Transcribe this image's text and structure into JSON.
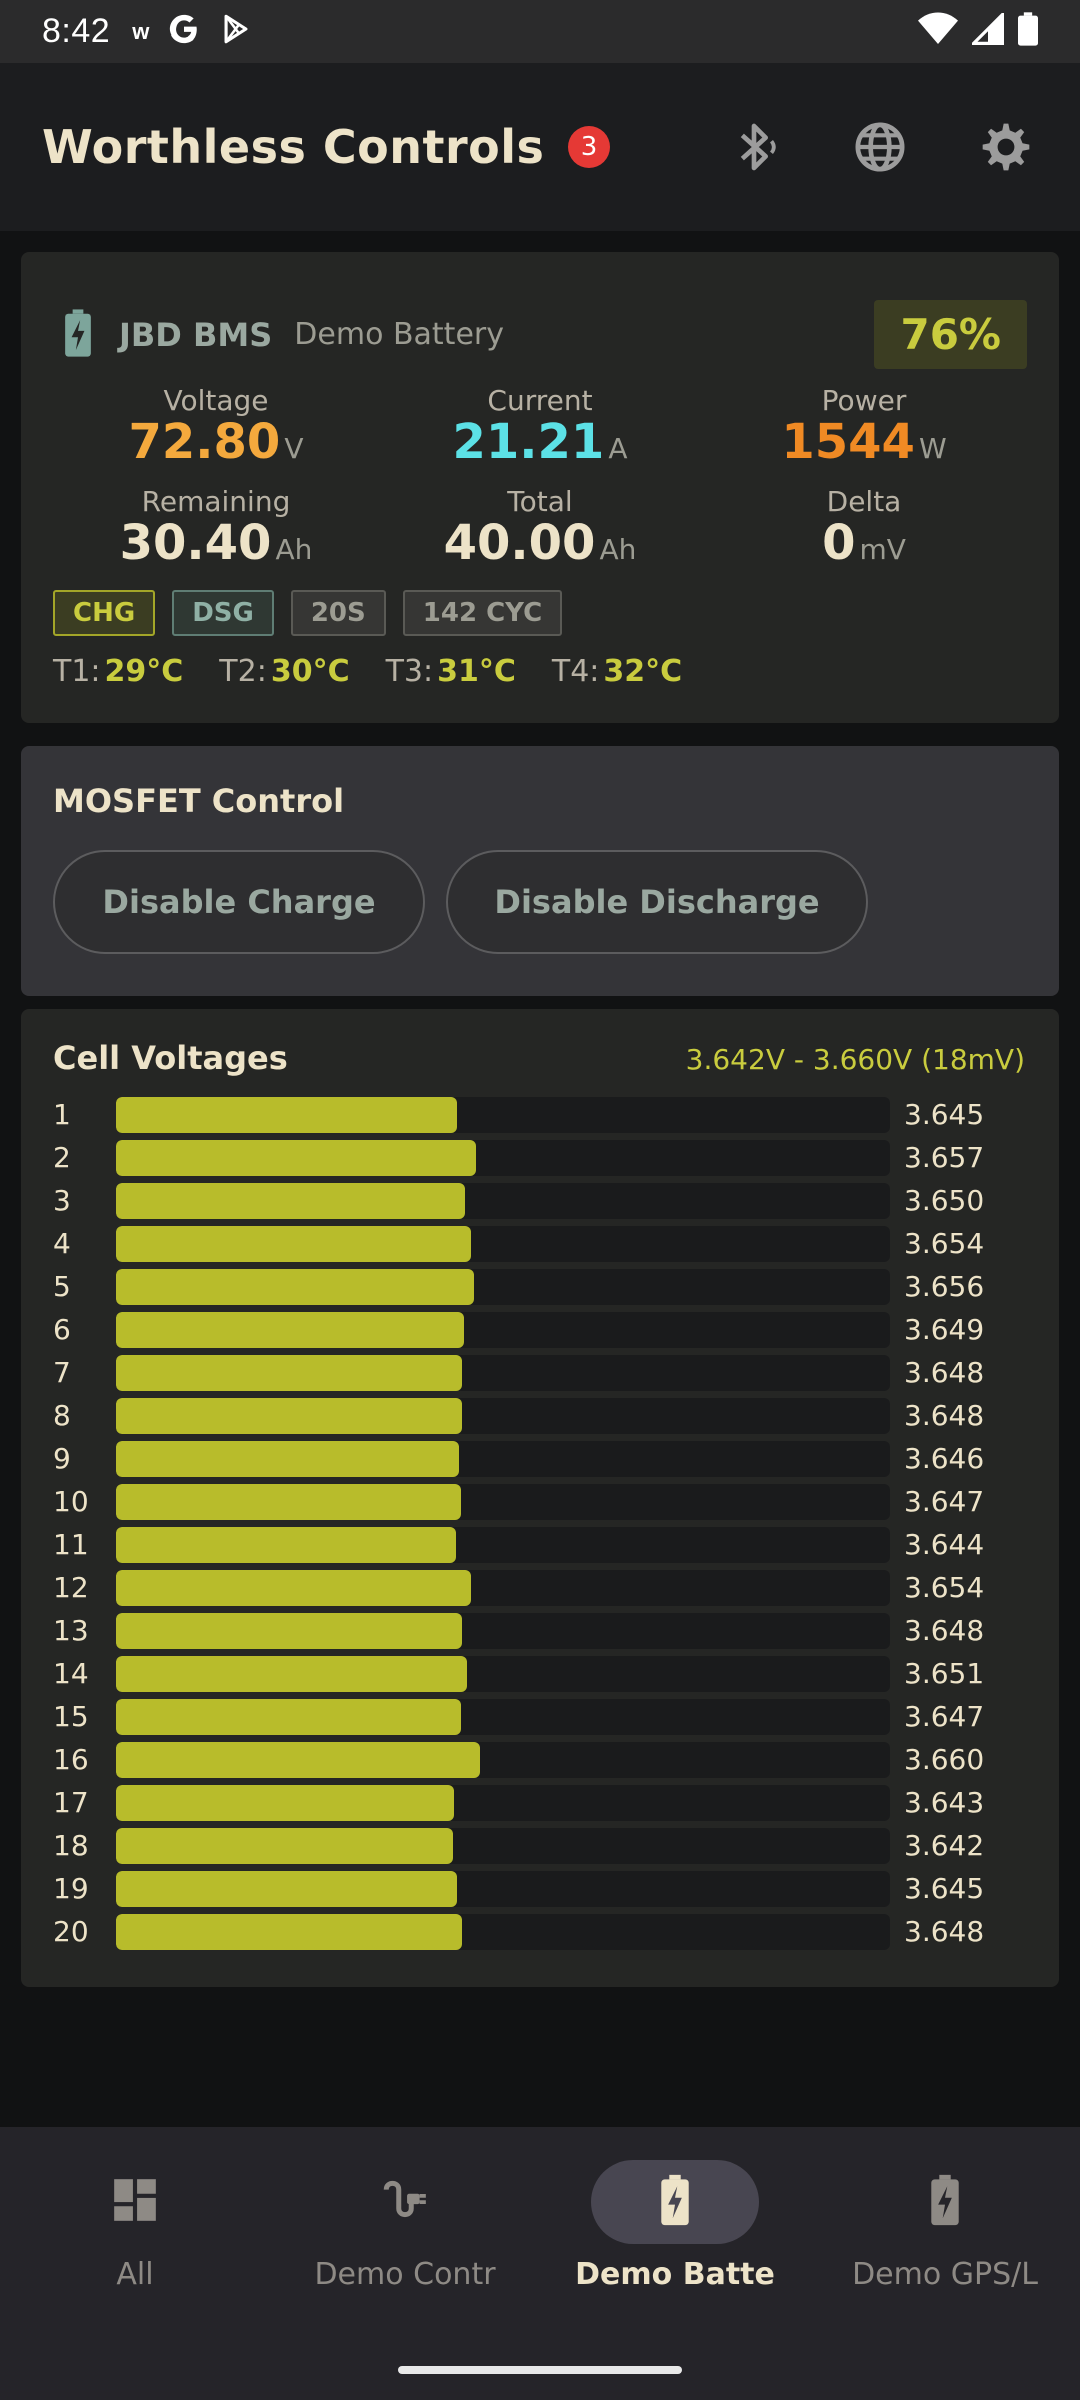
{
  "status_bar": {
    "time": "8:42",
    "left_icons": [
      "w-icon",
      "google-icon",
      "play-store-icon"
    ],
    "right_icons": [
      "wifi-icon",
      "signal-icon",
      "battery-icon"
    ],
    "w_label": "w"
  },
  "app_bar": {
    "title": "Worthless Controls",
    "notification_count": "3"
  },
  "bms": {
    "name": "JBD BMS",
    "subtitle": "Demo Battery",
    "soc": "76%",
    "voltage": {
      "label": "Voltage",
      "value": "72.80",
      "unit": "V"
    },
    "current": {
      "label": "Current",
      "value": "21.21",
      "unit": "A"
    },
    "power": {
      "label": "Power",
      "value": "1544",
      "unit": "W"
    },
    "remaining": {
      "label": "Remaining",
      "value": "30.40",
      "unit": "Ah"
    },
    "total": {
      "label": "Total",
      "value": "40.00",
      "unit": "Ah"
    },
    "delta": {
      "label": "Delta",
      "value": "0",
      "unit": "mV"
    },
    "chips": [
      "CHG",
      "DSG",
      "20S",
      "142 CYC"
    ],
    "temps": [
      {
        "label": "T1:",
        "value": "29°C"
      },
      {
        "label": "T2:",
        "value": "30°C"
      },
      {
        "label": "T3:",
        "value": "31°C"
      },
      {
        "label": "T4:",
        "value": "32°C"
      }
    ],
    "colors": {
      "voltage": "#f4a93d",
      "current": "#5ce1e6",
      "power": "#f08a24",
      "accent": "#c9cc3e"
    }
  },
  "mosfet": {
    "title": "MOSFET Control",
    "disable_charge": "Disable Charge",
    "disable_discharge": "Disable Discharge"
  },
  "cells": {
    "title": "Cell Voltages",
    "range": "3.642V - 3.660V  (18mV)",
    "items": [
      {
        "index": "1",
        "voltage": "3.645"
      },
      {
        "index": "2",
        "voltage": "3.657"
      },
      {
        "index": "3",
        "voltage": "3.650"
      },
      {
        "index": "4",
        "voltage": "3.654"
      },
      {
        "index": "5",
        "voltage": "3.656"
      },
      {
        "index": "6",
        "voltage": "3.649"
      },
      {
        "index": "7",
        "voltage": "3.648"
      },
      {
        "index": "8",
        "voltage": "3.648"
      },
      {
        "index": "9",
        "voltage": "3.646"
      },
      {
        "index": "10",
        "voltage": "3.647"
      },
      {
        "index": "11",
        "voltage": "3.644"
      },
      {
        "index": "12",
        "voltage": "3.654"
      },
      {
        "index": "13",
        "voltage": "3.648"
      },
      {
        "index": "14",
        "voltage": "3.651"
      },
      {
        "index": "15",
        "voltage": "3.647"
      },
      {
        "index": "16",
        "voltage": "3.660"
      },
      {
        "index": "17",
        "voltage": "3.643"
      },
      {
        "index": "18",
        "voltage": "3.642"
      },
      {
        "index": "19",
        "voltage": "3.645"
      },
      {
        "index": "20",
        "voltage": "3.648"
      }
    ]
  },
  "bottom_nav": {
    "items": [
      {
        "label": "All",
        "icon": "dashboard-icon",
        "active": false
      },
      {
        "label": "Demo Contr",
        "icon": "plug-icon",
        "active": false
      },
      {
        "label": "Demo Batte",
        "icon": "battery-charging-icon",
        "active": true
      },
      {
        "label": "Demo GPS/L",
        "icon": "battery-charging-icon",
        "active": false
      }
    ]
  }
}
